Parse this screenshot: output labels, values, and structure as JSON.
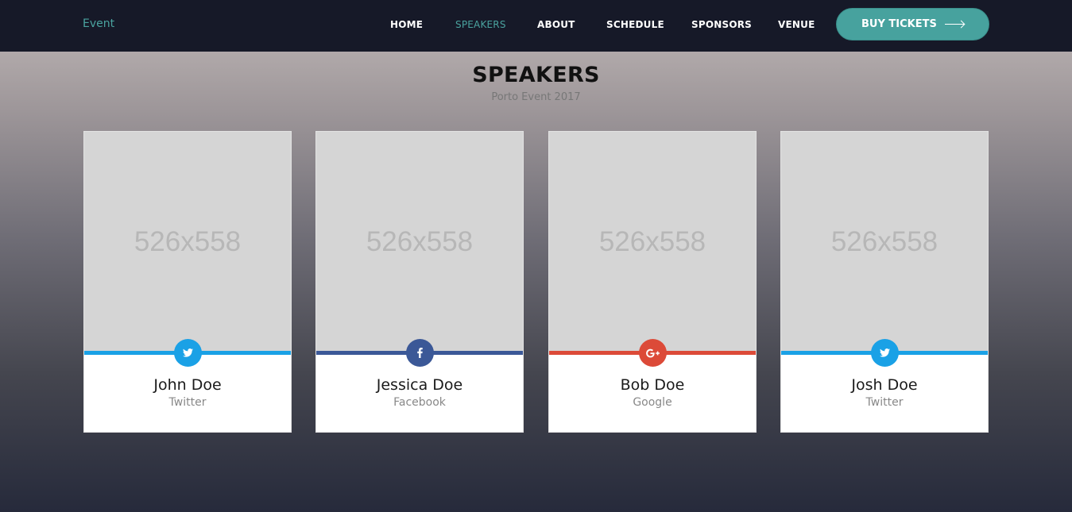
{
  "header": {
    "logo": "Event",
    "nav": [
      {
        "label": "HOME"
      },
      {
        "label": "SPEAKERS"
      },
      {
        "label": "ABOUT"
      },
      {
        "label": "SCHEDULE"
      },
      {
        "label": "SPONSORS"
      },
      {
        "label": "VENUE"
      }
    ],
    "active_nav": "SPEAKERS",
    "cta_label": "BUY TICKETS"
  },
  "section": {
    "title": "SPEAKERS",
    "subtitle": "Porto Event 2017"
  },
  "speakers": [
    {
      "name": "John Doe",
      "network": "Twitter",
      "photo_placeholder": "526x558",
      "icon": "twitter-icon",
      "color": "#1aa1e6"
    },
    {
      "name": "Jessica Doe",
      "network": "Facebook",
      "photo_placeholder": "526x558",
      "icon": "facebook-icon",
      "color": "#3b5897"
    },
    {
      "name": "Bob Doe",
      "network": "Google",
      "photo_placeholder": "526x558",
      "icon": "google-plus-icon",
      "color": "#dc4a38"
    },
    {
      "name": "Josh Doe",
      "network": "Twitter",
      "photo_placeholder": "526x558",
      "icon": "twitter-icon",
      "color": "#1aa1e6"
    }
  ],
  "colors": {
    "accent": "#47a29e",
    "header_bg": "#161928"
  }
}
